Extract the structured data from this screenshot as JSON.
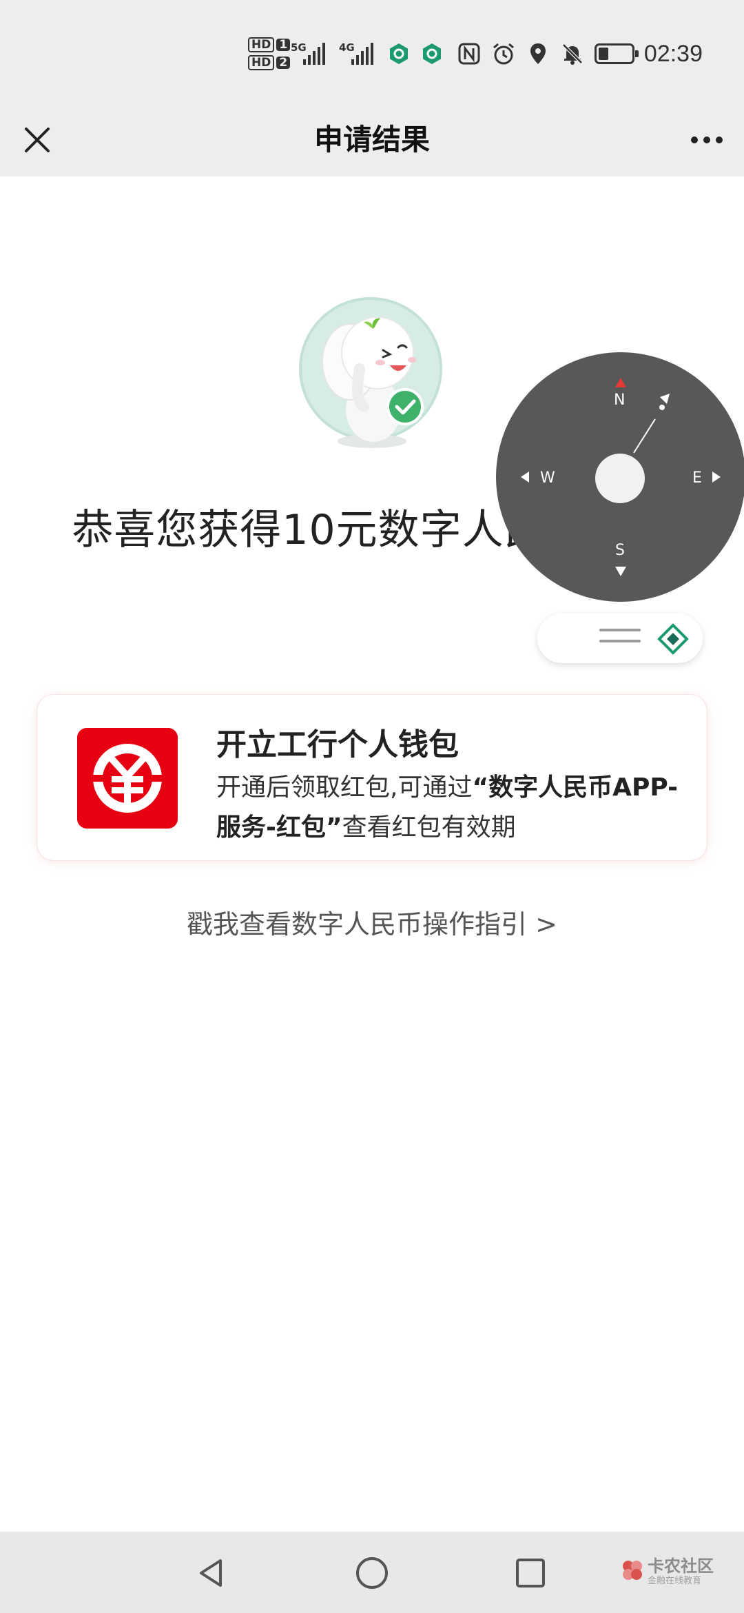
{
  "status_bar": {
    "sim1": "HD",
    "sim1_num": "1",
    "sim2": "HD",
    "sim2_num": "2",
    "network1": "5G",
    "network2": "4G",
    "battery_level": 0.3,
    "time": "02:39",
    "icons": [
      "app-badge-icon",
      "app-badge-icon",
      "nfc-icon",
      "alarm-icon",
      "location-icon",
      "mute-icon",
      "battery-icon"
    ]
  },
  "header": {
    "title": "申请结果",
    "close_icon": "close-icon",
    "more_icon": "more-icon"
  },
  "main": {
    "headline": "恭喜您获得10元数字人民币红包",
    "wallet_card": {
      "title": "开立工行个人钱包",
      "desc_prefix": "开通后领取红包,可通过",
      "desc_bold": "“数字人民币APP-服务-红包”",
      "desc_suffix": "查看红包有效期"
    },
    "guide_link": "戳我查看数字人民币操作指引 >"
  },
  "compass": {
    "north": "N",
    "south": "S",
    "west": "W",
    "east": "E"
  },
  "nav_bar": {
    "icons": [
      "back-icon",
      "home-icon",
      "recent-apps-icon"
    ]
  },
  "watermark": {
    "text": "卡农社区",
    "sub": "金融在线教育"
  },
  "colors": {
    "brand_red": "#e60012",
    "bar_gray": "#ededed",
    "compass_gray": "#585858",
    "accent_green": "#1a9a6e"
  }
}
